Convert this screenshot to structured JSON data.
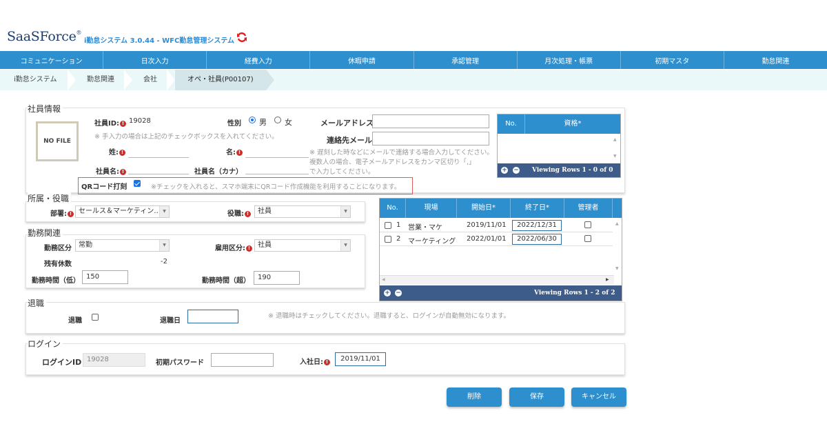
{
  "header": {
    "logo_text": "SaaSForce",
    "logo_mark": "®",
    "system_name": "i勤怠システム 3.0.44 - WFC勤怠管理システム",
    "refresh_icon": "refresh-icon",
    "accent_color": "#2e8fce"
  },
  "nav": {
    "items": [
      "コミュニケーション",
      "日次入力",
      "経費入力",
      "休暇申請",
      "承認管理",
      "月次処理・帳票",
      "初期マスタ",
      "勤怠関連"
    ]
  },
  "breadcrumb": {
    "items": [
      "i勤怠システム",
      "勤怠関連",
      "会社",
      "オペ・社員(P00107)"
    ]
  },
  "employee_info": {
    "section_title": "社員情報",
    "photo_placeholder": "NO FILE",
    "employee_id_label": "社員ID:",
    "employee_id_value": "19028",
    "manual_note": "※ 手入力の場合は上記のチェックボックスを入れてください。",
    "gender_label": "性別",
    "gender_male": "男",
    "gender_female": "女",
    "last_name_label": "姓:",
    "last_name_value": "",
    "first_name_label": "名:",
    "first_name_value": "",
    "full_name_label": "社員名:",
    "full_name_value": "",
    "kana_label": "社員名（カナ）",
    "kana_value": "",
    "email_label": "メールアドレス",
    "email_value": "",
    "contact_email_label": "連絡先メール",
    "contact_email_value": "",
    "contact_note_1": "※ 遅刻した時などにメールで連絡する場合入力してください。",
    "contact_note_2": "複数人の場合、電子メールアドレスをカンマ区切り「,」",
    "contact_note_3": "で入力してください。",
    "qr_label": "QRコード打刻",
    "qr_checked": true,
    "qr_note": "※チェックを入れると、スマホ端末にQRコード作成機能を利用することになります。"
  },
  "qualification_grid": {
    "col_no": "No.",
    "col_qualification": "資格*",
    "footer": "Viewing Rows 1 - 0 of 0"
  },
  "affiliation": {
    "section_title": "所属・役職",
    "dept_label": "部署:",
    "dept_value": "セールス＆マーケティン…",
    "role_label": "役職:",
    "role_value": "社員"
  },
  "site_grid": {
    "col_no": "No.",
    "col_site": "現場",
    "col_start": "開始日*",
    "col_end": "終了日*",
    "col_manager": "管理者",
    "rows": [
      {
        "no": "1",
        "site": "営業・マケ",
        "start": "2019/11/01",
        "end": "2022/12/31"
      },
      {
        "no": "2",
        "site": "マーケティング",
        "start": "2022/01/01",
        "end": "2022/06/30"
      }
    ],
    "footer": "Viewing Rows 1 - 2 of 2"
  },
  "work": {
    "section_title": "勤務関連",
    "type_label": "勤務区分",
    "type_value": "常勤",
    "employment_label": "雇用区分:",
    "employment_value": "社員",
    "paid_leave_label": "残有休数",
    "paid_leave_value": "-2",
    "hours_min_label": "勤務時間（低）",
    "hours_min_value": "150",
    "hours_max_label": "勤務時間（超）",
    "hours_max_value": "190"
  },
  "retirement": {
    "section_title": "退職",
    "retire_label": "退職",
    "retire_date_label": "退職日",
    "retire_date_value": "",
    "note": "※ 退職時はチェックしてください。退職すると、ログインが自動無効になります。"
  },
  "login": {
    "section_title": "ログイン",
    "login_id_label": "ログインID",
    "login_id_value": "19028",
    "init_password_label": "初期パスワード",
    "init_password_value": "",
    "join_date_label": "入社日:",
    "join_date_value": "2019/11/01"
  },
  "actions": {
    "delete": "削除",
    "save": "保存",
    "cancel": "キャンセル"
  }
}
